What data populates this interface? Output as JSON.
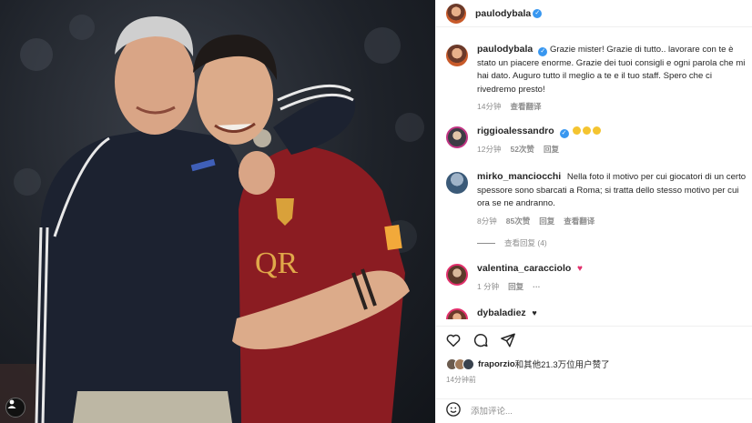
{
  "post": {
    "username": "paulodybala",
    "verified": true
  },
  "comments": [
    {
      "username": "paulodybala",
      "text": "Grazie mister! Grazie di tutto.. lavorare con te è stato un piacere enorme. Grazie dei tuoi consigli e ogni parola che mi hai dato. Auguro tutto il meglio a te e il tuo staff. Spero che ci rivedremo presto!",
      "time": "14分钟",
      "translate": "查看翻译"
    },
    {
      "username": "riggioalessandro",
      "time": "12分钟",
      "likes": "52次赞",
      "reply": "回复"
    },
    {
      "username": "mirko_manciocchi",
      "text": "Nella foto il motivo per cui giocatori di un certo spessore sono sbarcati a Roma; si tratta dello stesso motivo per cui ora se ne andranno.",
      "time": "8分钟",
      "likes": "85次赞",
      "reply": "回复",
      "translate": "查看翻译",
      "view_replies": "查看回复 (4)"
    },
    {
      "username": "valentina_caracciolo",
      "time": "1 分钟",
      "reply": "回复",
      "more": "···"
    },
    {
      "username": "dybaladiez"
    }
  ],
  "likes_summary": {
    "user": "fraporzio",
    "rest": "和其他21.3万位用户赞了"
  },
  "post_time": "14分钟前",
  "composer": {
    "placeholder": "添加评论..."
  },
  "icons": {
    "like": "heart-outline-icon",
    "comment": "comment-bubble-icon",
    "share": "paper-plane-icon",
    "emoji": "smiley-icon",
    "verified": "verified-badge-icon"
  },
  "colors": {
    "verified": "#3897f0",
    "meta_text": "#8e8e8e",
    "heart": "#e1306c",
    "jersey": "#8b1c22"
  }
}
